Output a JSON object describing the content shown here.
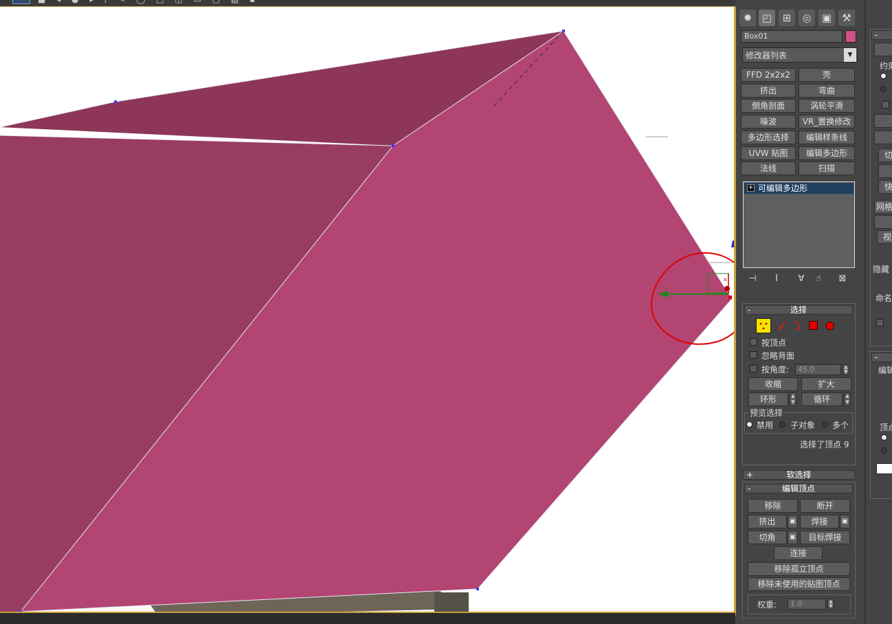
{
  "viewport": {
    "topbar_glyphs": [
      "■",
      "◂",
      "●",
      "▸",
      "/",
      "✎",
      "◯",
      "□",
      "◫",
      "▭",
      "▢",
      "▧",
      "▪"
    ],
    "colors": {
      "face_top": "#8e3659",
      "face_left": "#993c62",
      "face_front": "#b24572",
      "highlight": "#e00000",
      "gizmo_x": "#c00000",
      "gizmo_y": "#1a8a1a"
    }
  },
  "panel": {
    "tabs": [
      {
        "icon": "create-icon",
        "glyph": "✹"
      },
      {
        "icon": "modify-icon",
        "glyph": "◰"
      },
      {
        "icon": "hierarchy-icon",
        "glyph": "⊞"
      },
      {
        "icon": "motion-icon",
        "glyph": "◎"
      },
      {
        "icon": "display-icon",
        "glyph": "▣"
      },
      {
        "icon": "utilities-icon",
        "glyph": "⚒"
      }
    ],
    "object_name": "Box01",
    "object_color": "#d0508a",
    "modifier_list": "修改器列表",
    "modifier_buttons": [
      [
        "FFD 2x2x2",
        "壳"
      ],
      [
        "挤出",
        "弯曲"
      ],
      [
        "倒角剖面",
        "涡轮平滑"
      ],
      [
        "噪波",
        "VR_置换修改"
      ],
      [
        "多边形选择",
        "编辑样条线"
      ],
      [
        "UVW 贴图",
        "编辑多边形"
      ],
      [
        "法线",
        "扫描"
      ]
    ],
    "stack_item": "可编辑多边形",
    "stack_tools": [
      "⊣",
      "I",
      "∀",
      "☝",
      "⊠"
    ],
    "selection": {
      "title": "选择",
      "sign": "-",
      "by_vertex": "按顶点",
      "ignore_backfacing": "忽略背面",
      "by_angle": "按角度:",
      "angle_value": "45.0",
      "shrink": "收缩",
      "grow": "扩大",
      "ring": "环形",
      "loop": "循环",
      "preview_title": "预览选择",
      "preview_options": [
        "禁用",
        "子对象",
        "多个"
      ],
      "status": "选择了顶点 9"
    },
    "soft_selection": {
      "title": "软选择",
      "sign": "+"
    },
    "edit_vertices": {
      "title": "编辑顶点",
      "sign": "-",
      "remove": "移除",
      "break": "断开",
      "extrude": "挤出",
      "weld": "焊接",
      "chamfer": "切角",
      "target_weld": "目标焊接",
      "connect": "连接",
      "remove_isolated": "移除孤立顶点",
      "remove_unused_map": "移除未使用的贴图顶点",
      "weight_label": "权重:",
      "weight_value": "1.0"
    }
  },
  "panel2": {
    "signs": [
      "-",
      "-",
      "-"
    ],
    "labels": [
      "约束",
      "切",
      "快",
      "网格",
      "视",
      "隐藏",
      "命名",
      "编辑",
      "顶点"
    ]
  }
}
